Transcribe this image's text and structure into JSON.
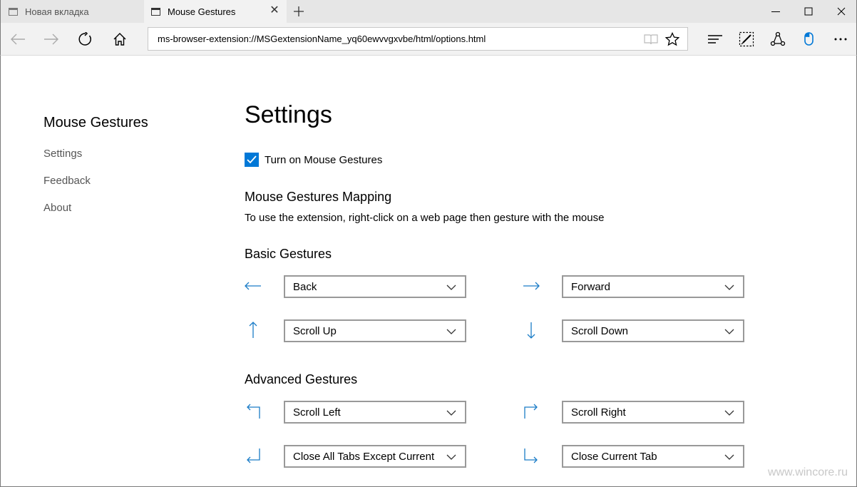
{
  "browser": {
    "tabs": [
      {
        "label": "Новая вкладка",
        "active": false
      },
      {
        "label": "Mouse Gestures",
        "active": true
      }
    ],
    "url": "ms-browser-extension://MSGextensionName_yq60ewvvgxvbe/html/options.html"
  },
  "sidebar": {
    "title": "Mouse Gestures",
    "items": [
      {
        "label": "Settings"
      },
      {
        "label": "Feedback"
      },
      {
        "label": "About"
      }
    ]
  },
  "main": {
    "title": "Settings",
    "enable_checkbox": {
      "label": "Turn on Mouse Gestures",
      "checked": true
    },
    "mapping_heading": "Mouse Gestures Mapping",
    "mapping_description": "To use the extension, right-click on a web page then gesture with the mouse",
    "basic_heading": "Basic Gestures",
    "basic": [
      {
        "gesture": "left-arrow-icon",
        "action": "Back"
      },
      {
        "gesture": "right-arrow-icon",
        "action": "Forward"
      },
      {
        "gesture": "up-arrow-icon",
        "action": "Scroll Up"
      },
      {
        "gesture": "down-arrow-icon",
        "action": "Scroll Down"
      }
    ],
    "advanced_heading": "Advanced Gestures",
    "advanced": [
      {
        "gesture": "up-left-arrow-icon",
        "action": "Scroll Left"
      },
      {
        "gesture": "up-right-arrow-icon",
        "action": "Scroll Right"
      },
      {
        "gesture": "down-left-arrow-icon",
        "action": "Close All Tabs Except Current"
      },
      {
        "gesture": "down-right-arrow-icon",
        "action": "Close Current Tab"
      }
    ]
  },
  "watermark": "www.wincore.ru",
  "colors": {
    "accent": "#0078d7",
    "gesture_icon": "#1a7cc7"
  }
}
